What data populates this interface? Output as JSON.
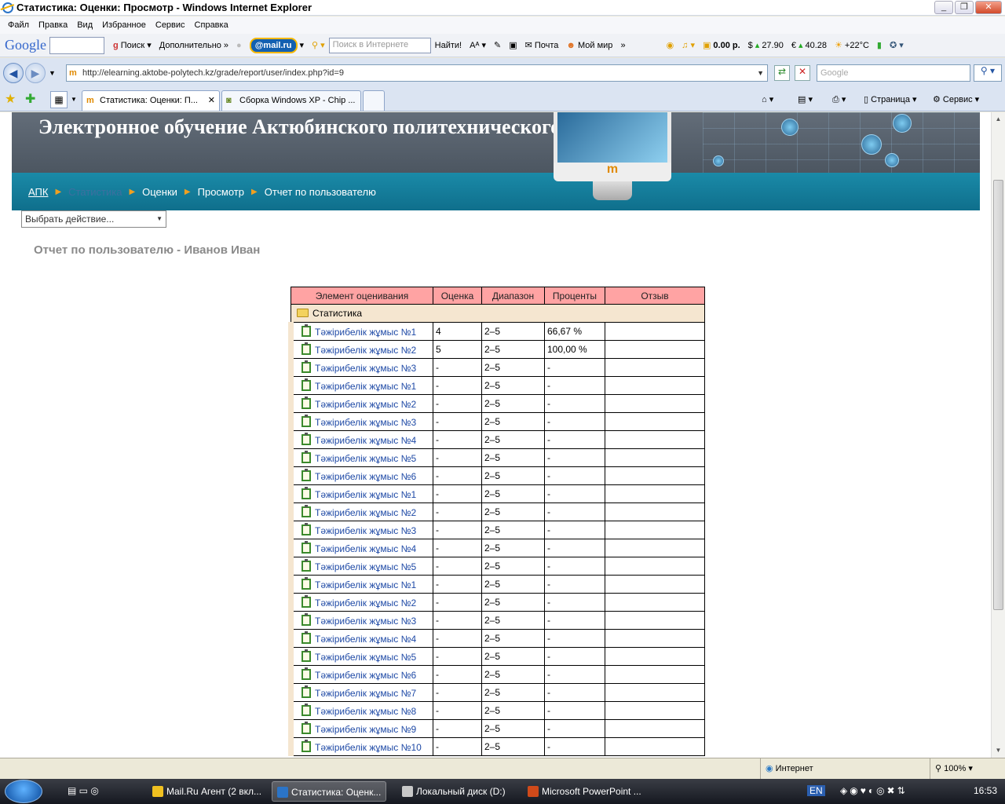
{
  "window": {
    "title": "Статистика: Оценки: Просмотр - Windows Internet Explorer"
  },
  "menu": [
    "Файл",
    "Правка",
    "Вид",
    "Избранное",
    "Сервис",
    "Справка"
  ],
  "toolbar": {
    "google_logo": "Google",
    "search_label": "Поиск",
    "more_label": "Дополнительно",
    "mailru_label": "@mail.ru",
    "internet_search_placeholder": "Поиск в Интернете",
    "find_label": "Найти!",
    "mail_label": "Почта",
    "myworld_label": "Мой мир",
    "balance": "0.00 р.",
    "usd": "27.90",
    "eur": "40.28",
    "temp": "+22°C"
  },
  "address": {
    "url": "http://elearning.aktobe-polytech.kz/grade/report/user/index.php?id=9",
    "search_placeholder": "Google"
  },
  "tabs": [
    {
      "label": "Статистика: Оценки: П...",
      "active": true
    },
    {
      "label": "Сборка Windows XP - Chip ...",
      "active": false
    }
  ],
  "commands": {
    "page": "Страница",
    "tools": "Сервис"
  },
  "banner": {
    "title": "Электронное обучение Актюбинского политехнического колледжа"
  },
  "breadcrumb": [
    {
      "label": "АПК",
      "kind": "link"
    },
    {
      "label": "Статистика",
      "kind": "dim"
    },
    {
      "label": "Оценки",
      "kind": "text"
    },
    {
      "label": "Просмотр",
      "kind": "text"
    },
    {
      "label": "Отчет по пользователю",
      "kind": "text"
    }
  ],
  "action_select": "Выбрать действие...",
  "page_title": "Отчет по пользователю - Иванов Иван",
  "table": {
    "headers": [
      "Элемент оценивания",
      "Оценка",
      "Диапазон",
      "Проценты",
      "Отзыв"
    ],
    "category": "Статистика",
    "rows": [
      [
        "Тәжірибелік жұмыс №1",
        "4",
        "2–5",
        "66,67 %",
        ""
      ],
      [
        "Тәжірибелік жұмыс №2",
        "5",
        "2–5",
        "100,00 %",
        ""
      ],
      [
        "Тәжірибелік жұмыс №3",
        "-",
        "2–5",
        "-",
        ""
      ],
      [
        "Тәжірибелік жұмыс №1",
        "-",
        "2–5",
        "-",
        ""
      ],
      [
        "Тәжірибелік жұмыс №2",
        "-",
        "2–5",
        "-",
        ""
      ],
      [
        "Тәжірибелік жұмыс №3",
        "-",
        "2–5",
        "-",
        ""
      ],
      [
        "Тәжірибелік жұмыс №4",
        "-",
        "2–5",
        "-",
        ""
      ],
      [
        "Тәжірибелік жұмыс №5",
        "-",
        "2–5",
        "-",
        ""
      ],
      [
        "Тәжірибелік жұмыс №6",
        "-",
        "2–5",
        "-",
        ""
      ],
      [
        "Тәжірибелік жұмыс №1",
        "-",
        "2–5",
        "-",
        ""
      ],
      [
        "Тәжірибелік жұмыс №2",
        "-",
        "2–5",
        "-",
        ""
      ],
      [
        "Тәжірибелік жұмыс №3",
        "-",
        "2–5",
        "-",
        ""
      ],
      [
        "Тәжірибелік жұмыс №4",
        "-",
        "2–5",
        "-",
        ""
      ],
      [
        "Тәжірибелік жұмыс №5",
        "-",
        "2–5",
        "-",
        ""
      ],
      [
        "Тәжірибелік жұмыс №1",
        "-",
        "2–5",
        "-",
        ""
      ],
      [
        "Тәжірибелік жұмыс №2",
        "-",
        "2–5",
        "-",
        ""
      ],
      [
        "Тәжірибелік жұмыс №3",
        "-",
        "2–5",
        "-",
        ""
      ],
      [
        "Тәжірибелік жұмыс №4",
        "-",
        "2–5",
        "-",
        ""
      ],
      [
        "Тәжірибелік жұмыс №5",
        "-",
        "2–5",
        "-",
        ""
      ],
      [
        "Тәжірибелік жұмыс №6",
        "-",
        "2–5",
        "-",
        ""
      ],
      [
        "Тәжірибелік жұмыс №7",
        "-",
        "2–5",
        "-",
        ""
      ],
      [
        "Тәжірибелік жұмыс №8",
        "-",
        "2–5",
        "-",
        ""
      ],
      [
        "Тәжірибелік жұмыс №9",
        "-",
        "2–5",
        "-",
        ""
      ],
      [
        "Тәжірибелік жұмыс №10",
        "-",
        "2–5",
        "-",
        ""
      ]
    ]
  },
  "status": {
    "zone": "Интернет",
    "zoom": "100%"
  },
  "taskbar": {
    "buttons": [
      {
        "label": "Mail.Ru Агент (2 вкл...",
        "active": false,
        "color": "#f0c020"
      },
      {
        "label": "Статистика: Оценк...",
        "active": true,
        "color": "#2b74c7"
      },
      {
        "label": "Локальный диск (D:)",
        "active": false,
        "color": "#c8c8c8"
      },
      {
        "label": "Microsoft PowerPoint ...",
        "active": false,
        "color": "#d04a1a"
      }
    ],
    "lang": "EN",
    "clock": "16:53"
  },
  "colors": {
    "nav_bg": "#1a8aa8",
    "header_bg": "#ffa3a3",
    "category_bg": "#f5e6d0",
    "link": "#1f4aa6"
  }
}
